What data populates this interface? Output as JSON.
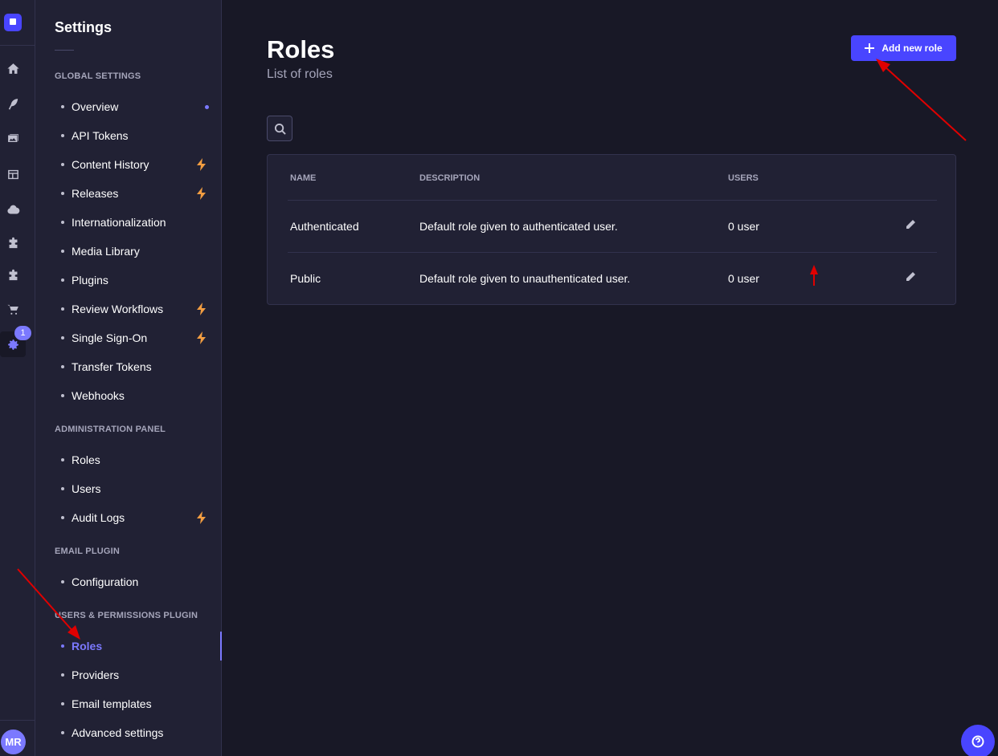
{
  "rail": {
    "badge_count": "1",
    "avatar_initials": "MR",
    "icons": [
      "home-icon",
      "feather-icon",
      "images-icon",
      "layout-icon",
      "cloud-icon",
      "puzzle-icon",
      "puzzle-icon",
      "cart-icon",
      "gear-icon"
    ]
  },
  "subnav": {
    "title": "Settings",
    "sections": {
      "global": "GLOBAL SETTINGS",
      "admin": "ADMINISTRATION PANEL",
      "email": "EMAIL PLUGIN",
      "users_perm": "USERS & PERMISSIONS PLUGIN"
    },
    "global_items": [
      "Overview",
      "API Tokens",
      "Content History",
      "Releases",
      "Internationalization",
      "Media Library",
      "Plugins",
      "Review Workflows",
      "Single Sign-On",
      "Transfer Tokens",
      "Webhooks"
    ],
    "admin_items": [
      "Roles",
      "Users",
      "Audit Logs"
    ],
    "email_items": [
      "Configuration"
    ],
    "up_items": [
      "Roles",
      "Providers",
      "Email templates",
      "Advanced settings"
    ]
  },
  "main": {
    "title": "Roles",
    "subtitle": "List of roles",
    "add_button_label": "Add new role",
    "table": {
      "headers": {
        "name": "NAME",
        "description": "DESCRIPTION",
        "users": "USERS"
      },
      "rows": [
        {
          "name": "Authenticated",
          "description": "Default role given to authenticated user.",
          "users": "0 user"
        },
        {
          "name": "Public",
          "description": "Default role given to unauthenticated user.",
          "users": "0 user"
        }
      ]
    }
  },
  "colors": {
    "accent": "#4945ff",
    "accent_light": "#7b79ff",
    "premium_bolt": "#f29d41",
    "annotation_arrow": "#e00000"
  }
}
